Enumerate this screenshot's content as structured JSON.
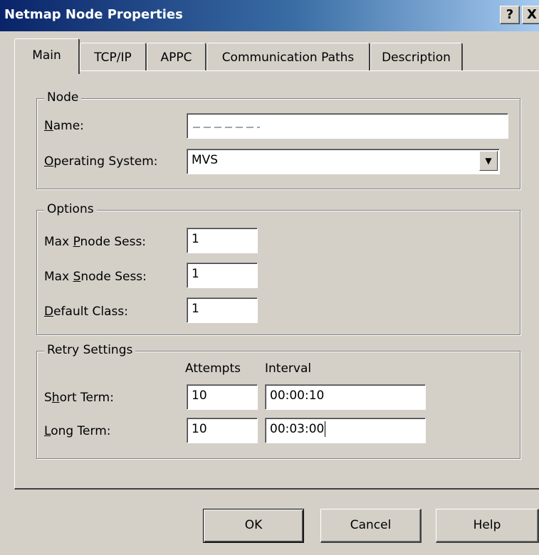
{
  "window": {
    "title": "Netmap Node Properties",
    "help_glyph": "?",
    "close_glyph": "X"
  },
  "tabs": [
    {
      "label": "Main",
      "active": true
    },
    {
      "label": "TCP/IP",
      "active": false
    },
    {
      "label": "APPC",
      "active": false
    },
    {
      "label": "Communication Paths",
      "active": false
    },
    {
      "label": "Description",
      "active": false
    }
  ],
  "node": {
    "group_label": "Node",
    "name_label": {
      "mnemonic": "N",
      "rest": "ame:"
    },
    "name_value": "",
    "os_label": {
      "mnemonic": "O",
      "rest": "perating System:"
    },
    "os_value": "MVS",
    "dropdown_glyph": "▼"
  },
  "options": {
    "group_label": "Options",
    "pnode_label": {
      "before": "Max ",
      "mnemonic": "P",
      "rest": "node Sess:"
    },
    "pnode_value": "1",
    "snode_label": {
      "before": "Max ",
      "mnemonic": "S",
      "rest": "node Sess:"
    },
    "snode_value": "1",
    "class_label": {
      "mnemonic": "D",
      "rest": "efault Class:"
    },
    "class_value": "1"
  },
  "retry": {
    "group_label": "Retry Settings",
    "attempts_header": "Attempts",
    "interval_header": "Interval",
    "short_label": {
      "before": "S",
      "mnemonic": "h",
      "rest": "ort Term:"
    },
    "short_attempts": "10",
    "short_interval": "00:00:10",
    "long_label": {
      "mnemonic": "L",
      "rest": "ong Term:"
    },
    "long_attempts": "10",
    "long_interval": "00:03:00"
  },
  "buttons": {
    "ok": "OK",
    "cancel": "Cancel",
    "help": "Help"
  }
}
